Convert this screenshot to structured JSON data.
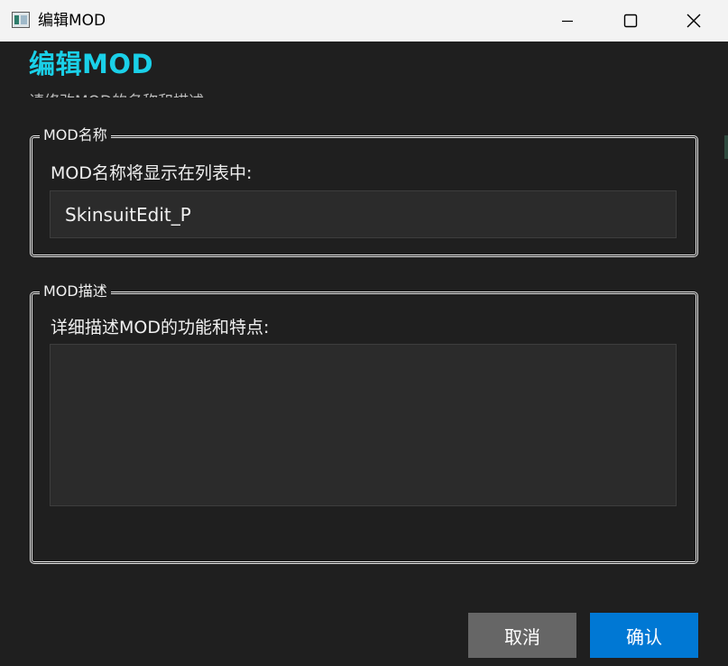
{
  "window": {
    "title": "编辑MOD",
    "controls": {
      "minimize_icon": "minimize-icon",
      "maximize_icon": "maximize-icon",
      "close_icon": "close-icon"
    }
  },
  "dialog": {
    "heading": "编辑MOD",
    "subheading": "请修改MOD的名称和描述",
    "name_group": {
      "legend": "MOD名称",
      "label": "MOD名称将显示在列表中:",
      "value": "SkinsuitEdit_P"
    },
    "desc_group": {
      "legend": "MOD描述",
      "label": "详细描述MOD的功能和特点:",
      "value": ""
    },
    "buttons": {
      "cancel": "取消",
      "confirm": "确认"
    }
  },
  "colors": {
    "accent": "#1ad0e8",
    "background": "#1f1f1f",
    "primary_button": "#0078d4",
    "secondary_button": "#666666"
  }
}
